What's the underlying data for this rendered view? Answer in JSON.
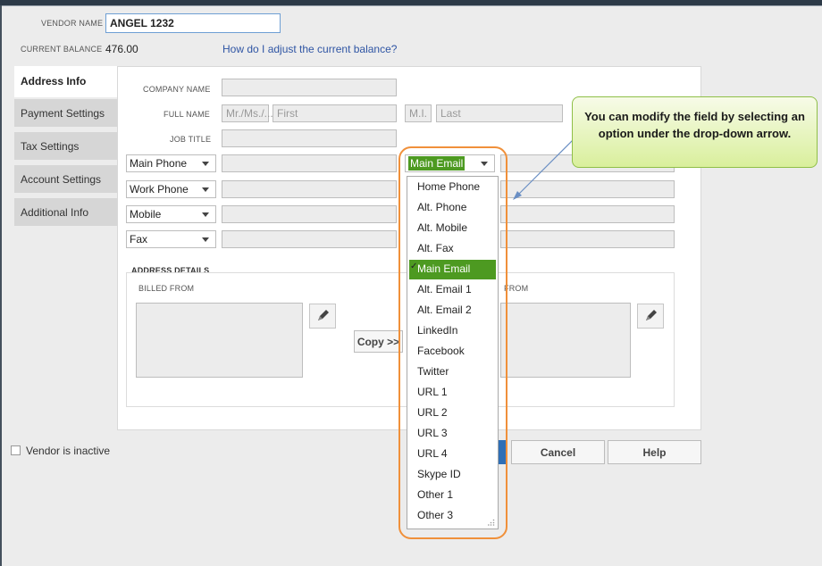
{
  "header": {
    "vendor_name_label": "VENDOR NAME",
    "vendor_name_value": "ANGEL 1232",
    "current_balance_label": "CURRENT BALANCE",
    "current_balance_value": "476.00",
    "adjust_link": "How do I adjust the current balance?"
  },
  "tabs": [
    {
      "label": "Address Info",
      "active": true
    },
    {
      "label": "Payment Settings"
    },
    {
      "label": "Tax Settings"
    },
    {
      "label": "Account Settings"
    },
    {
      "label": "Additional Info"
    }
  ],
  "form": {
    "company_name_label": "COMPANY NAME",
    "full_name_label": "FULL NAME",
    "job_title_label": "JOB TITLE",
    "salutation_placeholder": "Mr./Ms./...",
    "first_placeholder": "First",
    "mi_placeholder": "M.I.",
    "last_placeholder": "Last",
    "phone_selects": [
      "Main Phone",
      "Work Phone",
      "Mobile",
      "Fax"
    ],
    "email_select": "Main Email"
  },
  "address": {
    "section_label": "ADDRESS DETAILS",
    "billed_from_label": "BILLED FROM",
    "shipped_from_label": "FROM",
    "copy_button": "Copy >>"
  },
  "footer": {
    "vendor_inactive_label": "Vendor is inactive",
    "cancel_button": "Cancel",
    "help_button": "Help"
  },
  "dropdown": {
    "options": [
      "Home Phone",
      "Alt. Phone",
      "Alt. Mobile",
      "Alt. Fax",
      "Main Email",
      "Alt. Email 1",
      "Alt. Email 2",
      "LinkedIn",
      "Facebook",
      "Twitter",
      "URL 1",
      "URL 2",
      "URL 3",
      "URL 4",
      "Skype ID",
      "Other 1",
      "Other 3"
    ],
    "selected": "Main Email",
    "check_mark": "✓"
  },
  "callout": {
    "text": "You can modify the field by selecting an option under the drop-down arrow."
  },
  "colors": {
    "accent_green": "#4d9a21",
    "highlight_orange": "#f0903a",
    "link_blue": "#2f55a4"
  }
}
